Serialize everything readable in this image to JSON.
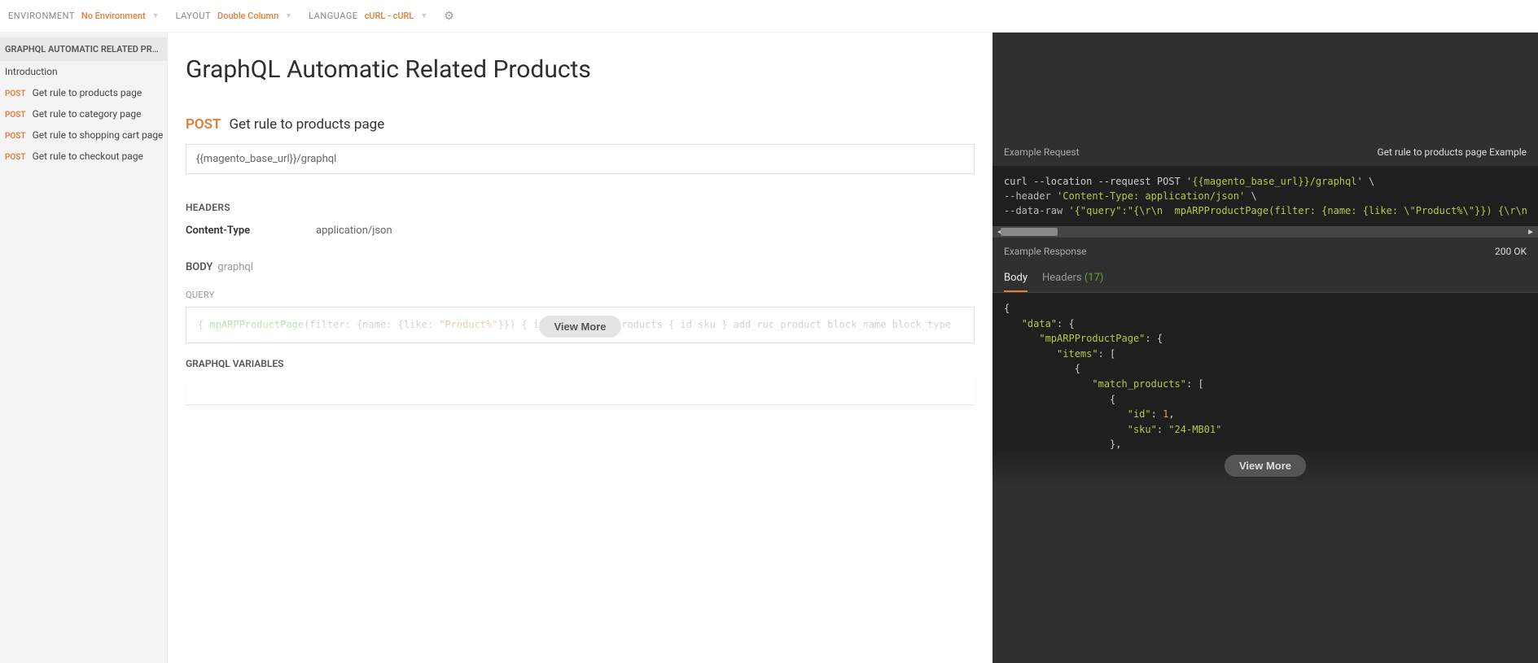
{
  "topbar": {
    "env_label": "ENVIRONMENT",
    "env_value": "No Environment",
    "layout_label": "LAYOUT",
    "layout_value": "Double Column",
    "lang_label": "LANGUAGE",
    "lang_value": "cURL - cURL"
  },
  "sidebar": {
    "collection": "GRAPHQL AUTOMATIC RELATED PRO…",
    "items": [
      {
        "label": "Introduction",
        "method": ""
      },
      {
        "label": "Get rule to products page",
        "method": "POST"
      },
      {
        "label": "Get rule to category page",
        "method": "POST"
      },
      {
        "label": "Get rule to shopping cart page",
        "method": "POST"
      },
      {
        "label": "Get rule to checkout page",
        "method": "POST"
      }
    ]
  },
  "main": {
    "title": "GraphQL Automatic Related Products",
    "method": "POST",
    "name": "Get rule to products page",
    "url": "{{magento_base_url}}/graphql",
    "headers_label": "HEADERS",
    "header_key": "Content-Type",
    "header_val": "application/json",
    "body_label": "BODY",
    "body_sub": "graphql",
    "query_label": "QUERY",
    "gvars_label": "GRAPHQL VARIABLES",
    "viewmore": "View More",
    "query_code": {
      "open": "{",
      "fn": "mpARPProductPage",
      "args_pre": "(filter: {name: {like: ",
      "args_str": "\"Product%\"",
      "args_post": "}}) {",
      "l_items": "    items {",
      "l_mp": "      match_products {",
      "l_id": "        id",
      "l_sku": "        sku",
      "l_close": "      }",
      "l_add": "      add_ruc_product",
      "l_bn": "      block_name",
      "l_bt": "      block_type"
    }
  },
  "right": {
    "req_label": "Example Request",
    "req_name": "Get rule to products page Example",
    "curl": {
      "l1a": "curl --location --request POST ",
      "l1b": "'{{magento_base_url}}/graphql'",
      "l1c": " \\",
      "l2a": "--header ",
      "l2b": "'Content-Type: application/json'",
      "l2c": " \\",
      "l3a": "--data-raw ",
      "l3b": "'{\"query\":\"{\\r\\n  mpARPProductPage(filter: {name: {like: \\\"Product%\\\"}}) {\\r\\n    items {\\r\\n      match_produ"
    },
    "resp_label": "Example Response",
    "status": "200 OK",
    "tab_body": "Body",
    "tab_headers": "Headers",
    "headers_count": "(17)",
    "json": {
      "l1": "{",
      "l2k": "\"data\"",
      "l2": ": {",
      "l3k": "\"mpARPProductPage\"",
      "l3": ": {",
      "l4k": "\"items\"",
      "l4": ": [",
      "l5": "{",
      "l6k": "\"match_products\"",
      "l6": ": [",
      "l7": "{",
      "l8k": "\"id\"",
      "l8v": "1",
      "l8c": ",",
      "l9k": "\"sku\"",
      "l9v": "\"24-MB01\"",
      "l10": "},"
    }
  }
}
